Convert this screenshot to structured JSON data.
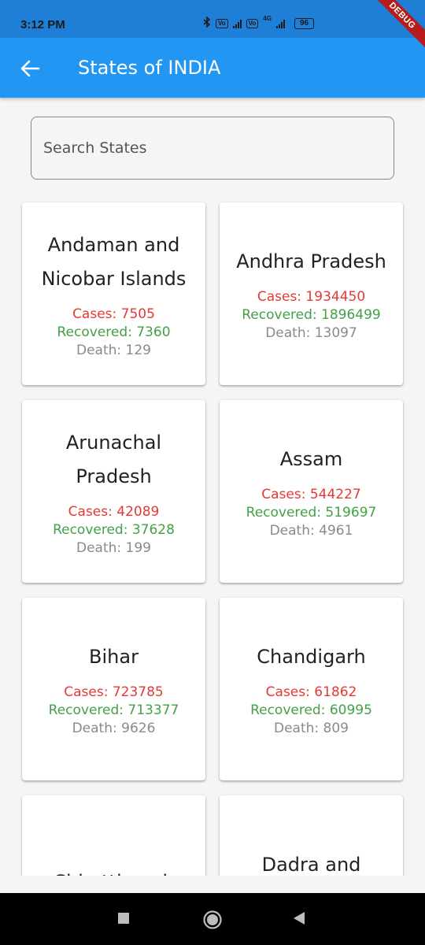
{
  "status_bar": {
    "time": "3:12 PM",
    "network": "4G",
    "battery": "96"
  },
  "debug_banner": "DEBUG",
  "app_bar": {
    "title": "States of INDIA"
  },
  "search": {
    "placeholder": "Search States",
    "value": ""
  },
  "states": [
    {
      "name": "Andaman and Nicobar Islands",
      "cases": "Cases: 7505",
      "recovered": "Recovered: 7360",
      "death": "Death: 129"
    },
    {
      "name": "Andhra Pradesh",
      "cases": "Cases: 1934450",
      "recovered": "Recovered: 1896499",
      "death": "Death: 13097"
    },
    {
      "name": "Arunachal Pradesh",
      "cases": "Cases: 42089",
      "recovered": "Recovered: 37628",
      "death": "Death: 199"
    },
    {
      "name": "Assam",
      "cases": "Cases: 544227",
      "recovered": "Recovered: 519697",
      "death": "Death: 4961"
    },
    {
      "name": "Bihar",
      "cases": "Cases: 723785",
      "recovered": "Recovered: 713377",
      "death": "Death: 9626"
    },
    {
      "name": "Chandigarh",
      "cases": "Cases: 61862",
      "recovered": "Recovered: 60995",
      "death": "Death: 809"
    },
    {
      "name": "Chhattisgarh",
      "cases": "",
      "recovered": "",
      "death": ""
    },
    {
      "name": "Dadra and Nagar Haveli",
      "cases": "",
      "recovered": "",
      "death": ""
    }
  ],
  "colors": {
    "app_bar": "#2196f3",
    "status_bar": "#1f7fd6",
    "cases": "#e53935",
    "recovered": "#43a047",
    "death": "#8a8a8a"
  }
}
